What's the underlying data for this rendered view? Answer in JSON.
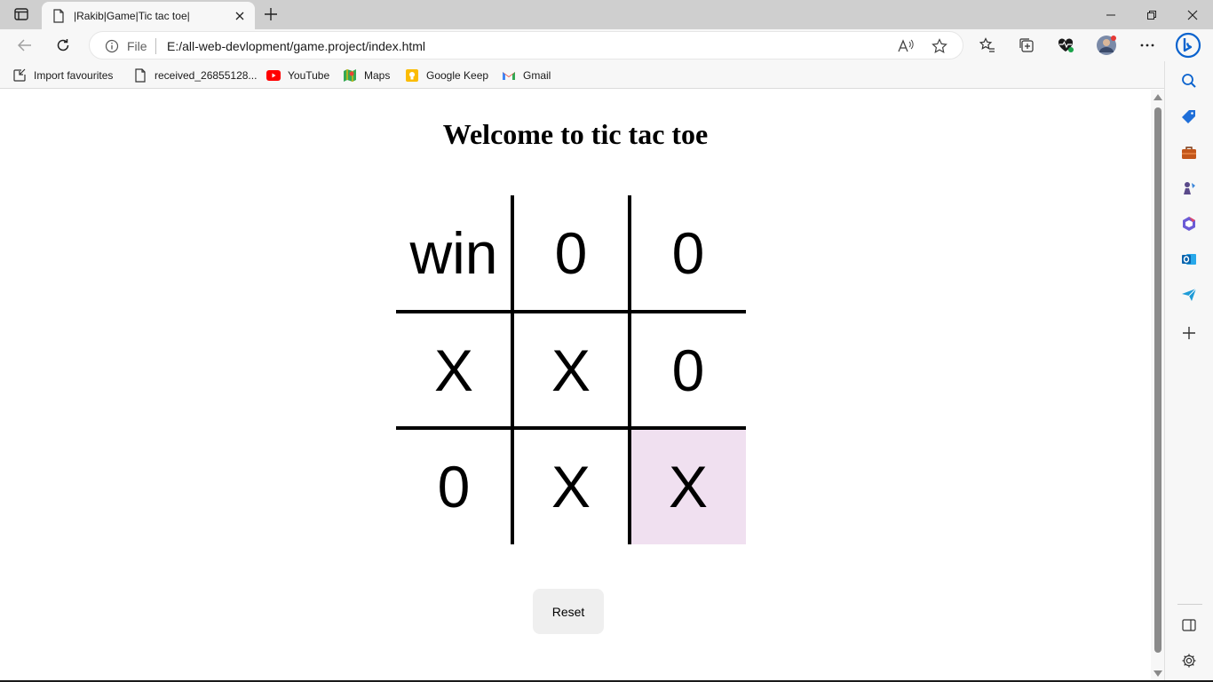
{
  "browser": {
    "tab_title": "|Rakib|Game|Tic tac toe|",
    "address_scheme": "File",
    "address_url": "E:/all-web-devlopment/game.project/index.html",
    "read_aloud_glyph": "Ă"
  },
  "bookmarks": [
    {
      "label": "Import favourites",
      "icon": "import-icon"
    },
    {
      "label": "received_26855128...",
      "icon": "file-icon"
    },
    {
      "label": "YouTube",
      "icon": "youtube-icon"
    },
    {
      "label": "Maps",
      "icon": "maps-icon"
    },
    {
      "label": "Google Keep",
      "icon": "keep-icon"
    },
    {
      "label": "Gmail",
      "icon": "gmail-icon"
    }
  ],
  "page": {
    "heading": "Welcome to tic tac toe",
    "board": [
      [
        "win",
        "0",
        "0"
      ],
      [
        "X",
        "X",
        "0"
      ],
      [
        "0",
        "X",
        "X"
      ]
    ],
    "highlight_cell": "row-3-col-3",
    "highlight_color": "#f0e0f0",
    "reset_label": "Reset"
  },
  "colors": {
    "accent_bing": "#0b63ce",
    "youtube": "#ff0000",
    "keep": "#fbbc04"
  }
}
